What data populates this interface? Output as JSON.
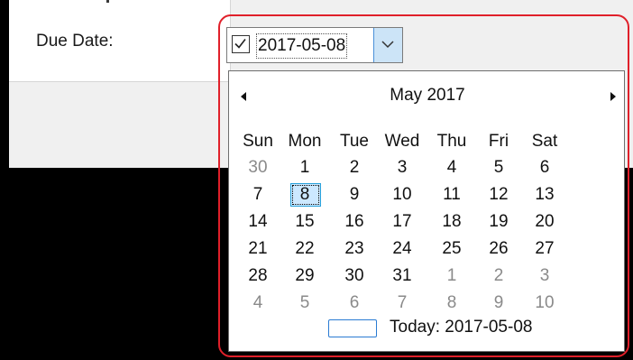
{
  "form": {
    "due_date_label": "Due Date:"
  },
  "date_picker": {
    "checked": true,
    "value": "2017-05-08"
  },
  "calendar": {
    "month_title": "May 2017",
    "weekdays": [
      "Sun",
      "Mon",
      "Tue",
      "Wed",
      "Thu",
      "Fri",
      "Sat"
    ],
    "weeks": [
      [
        "30",
        "1",
        "2",
        "3",
        "4",
        "5",
        "6"
      ],
      [
        "7",
        "8",
        "9",
        "10",
        "11",
        "12",
        "13"
      ],
      [
        "14",
        "15",
        "16",
        "17",
        "18",
        "19",
        "20"
      ],
      [
        "21",
        "22",
        "23",
        "24",
        "25",
        "26",
        "27"
      ],
      [
        "28",
        "29",
        "30",
        "31",
        "1",
        "2",
        "3"
      ],
      [
        "4",
        "5",
        "6",
        "7",
        "8",
        "9",
        "10"
      ]
    ],
    "today_label": "Today: 2017-05-08"
  },
  "colors": {
    "selection_fill": "#cce8ff",
    "selection_border": "#26a0da",
    "annotation_red": "#e0202a",
    "muted_day": "#8a8a8a"
  },
  "icons": {
    "checkbox": "check-icon",
    "dropdown": "chevron-down-icon",
    "prev": "triangle-left-icon",
    "next": "triangle-right-icon"
  }
}
